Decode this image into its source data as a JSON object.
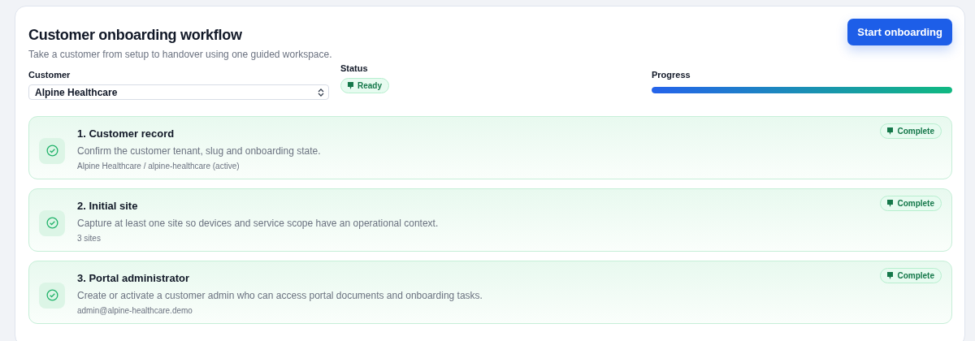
{
  "title": "Customer onboarding workflow",
  "subtitle": "Take a customer from setup to handover using one guided workspace.",
  "primary_button": "Start onboarding",
  "customer": {
    "label": "Customer",
    "value": "Alpine Healthcare"
  },
  "status": {
    "label": "Status",
    "badge": "Ready",
    "kind": "success"
  },
  "progress": {
    "label": "Progress",
    "level": 1
  },
  "steps": [
    {
      "title": "1. Customer record",
      "description": "Confirm the customer tenant, slug and onboarding state.",
      "detail": "Alpine Healthcare / alpine-healthcare (active)",
      "badge": "Complete",
      "complete": true
    },
    {
      "title": "2. Initial site",
      "description": "Capture at least one site so devices and service scope have an operational context.",
      "detail": "3 sites",
      "badge": "Complete",
      "complete": true
    },
    {
      "title": "3. Portal administrator",
      "description": "Create or activate a customer admin who can access portal documents and onboarding tasks.",
      "detail": "admin@alpine-healthcare.demo",
      "badge": "Complete",
      "complete": true
    }
  ]
}
